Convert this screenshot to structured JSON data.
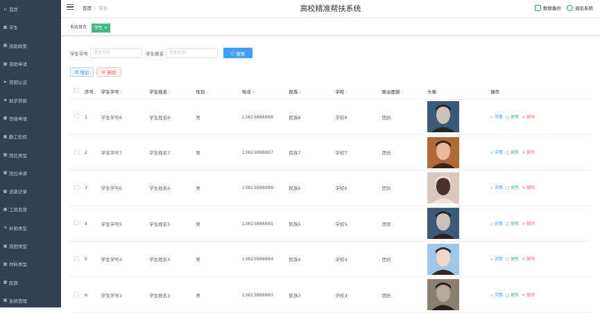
{
  "sidebar": {
    "items": [
      {
        "label": "首页",
        "icon": "home-icon"
      },
      {
        "label": "学生",
        "icon": "grid-icon"
      },
      {
        "label": "资助政策",
        "icon": "grid-icon"
      },
      {
        "label": "资助申请",
        "icon": "grid-icon"
      },
      {
        "label": "资困认证",
        "icon": "send-icon"
      },
      {
        "label": "助学贷款",
        "icon": "shield-icon"
      },
      {
        "label": "贷款申请",
        "icon": "grid-icon"
      },
      {
        "label": "勤工俭校",
        "icon": "grid-icon"
      },
      {
        "label": "岗位类型",
        "icon": "grid-icon"
      },
      {
        "label": "岗位申请",
        "icon": "grid-icon"
      },
      {
        "label": "还款记录",
        "icon": "grid-icon"
      },
      {
        "label": "工资发放",
        "icon": "grid-icon"
      },
      {
        "label": "补助类型",
        "icon": "sliders-icon"
      },
      {
        "label": "资困类型",
        "icon": "grid-icon"
      },
      {
        "label": "材料类型",
        "icon": "grid-icon"
      },
      {
        "label": "民族",
        "icon": "grid-icon"
      },
      {
        "label": "系统管理",
        "icon": "grid-icon"
      }
    ]
  },
  "header": {
    "breadcrumb_home": "首页",
    "breadcrumb_current": "学生",
    "title": "高校精准帮扶系统",
    "backup_label": "数据备份",
    "logout_label": "退出系统"
  },
  "tags": {
    "home": "系统首页",
    "active": "学生 ×"
  },
  "search": {
    "student_no_label": "学生学号",
    "student_no_placeholder": "学生学号",
    "student_name_label": "学生姓名",
    "student_name_placeholder": "学生姓名",
    "search_button": "搜索"
  },
  "actions": {
    "add": "增加",
    "delete": "删除"
  },
  "table": {
    "columns": [
      "序号",
      "学生学号",
      "学生姓名",
      "性别",
      "电话",
      "民族",
      "学校",
      "政治面貌",
      "头像",
      "操作"
    ],
    "rows": [
      {
        "index": "1",
        "student_no": "学生学号8",
        "name": "学生姓名8",
        "gender": "男",
        "phone": "13823888888",
        "ethnic": "民族8",
        "school": "学校8",
        "political": "团员"
      },
      {
        "index": "2",
        "student_no": "学生学号7",
        "name": "学生姓名7",
        "gender": "男",
        "phone": "13823888887",
        "ethnic": "民族7",
        "school": "学校7",
        "political": "团员"
      },
      {
        "index": "3",
        "student_no": "学生学号6",
        "name": "学生姓名6",
        "gender": "男",
        "phone": "13823888886",
        "ethnic": "民族6",
        "school": "学校6",
        "political": "团员"
      },
      {
        "index": "4",
        "student_no": "学生学号5",
        "name": "学生姓名5",
        "gender": "男",
        "phone": "13823888885",
        "ethnic": "民族5",
        "school": "学校5",
        "political": "团员"
      },
      {
        "index": "5",
        "student_no": "学生学号4",
        "name": "学生姓名4",
        "gender": "男",
        "phone": "13823888884",
        "ethnic": "民族4",
        "school": "学校4",
        "political": "团员"
      },
      {
        "index": "6",
        "student_no": "学生学号3",
        "name": "学生姓名3",
        "gender": "男",
        "phone": "13823888883",
        "ethnic": "民族3",
        "school": "学校3",
        "political": "团员"
      }
    ],
    "op_view": "详情",
    "op_edit": "更新",
    "op_delete": "删除"
  },
  "colors": {
    "sidebar_bg": "#304156",
    "primary": "#409eff",
    "success": "#42b983",
    "danger": "#f56c6c"
  }
}
